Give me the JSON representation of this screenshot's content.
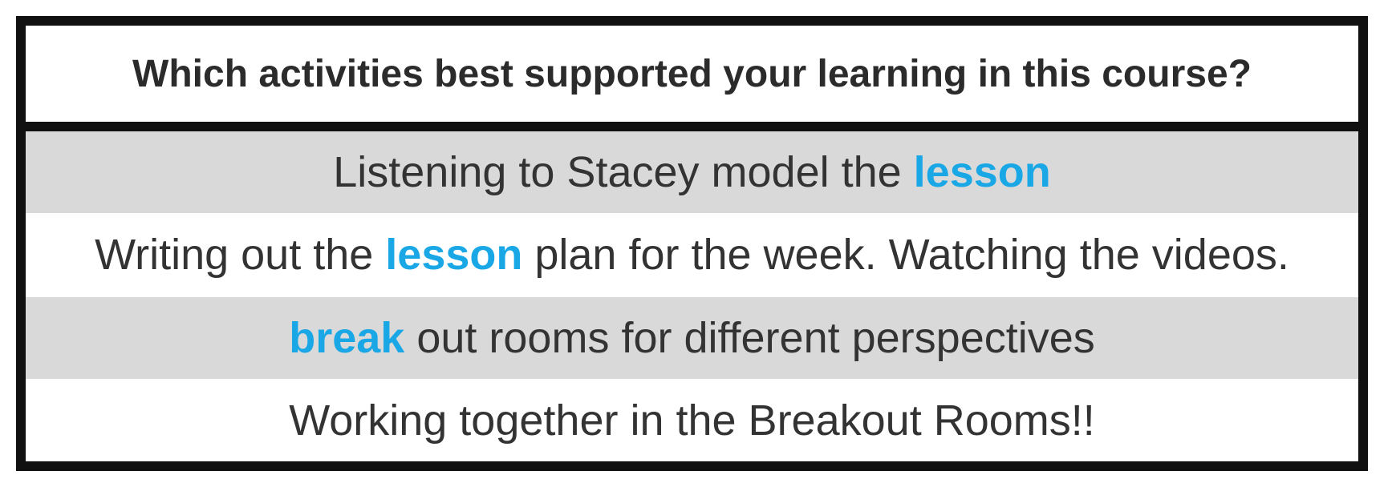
{
  "title": "Which activities best supported your learning in this course?",
  "highlight_color": "#1aa7e6",
  "responses": [
    {
      "before": "Listening to Stacey model the ",
      "highlight": "lesson",
      "after": ""
    },
    {
      "before": "Writing out the ",
      "highlight": "lesson",
      "after": " plan for the week. Watching the videos."
    },
    {
      "before": "",
      "highlight": "break",
      "after": " out rooms for different perspectives"
    },
    {
      "before": "Working together in the Breakout Rooms!!",
      "highlight": "",
      "after": ""
    }
  ]
}
